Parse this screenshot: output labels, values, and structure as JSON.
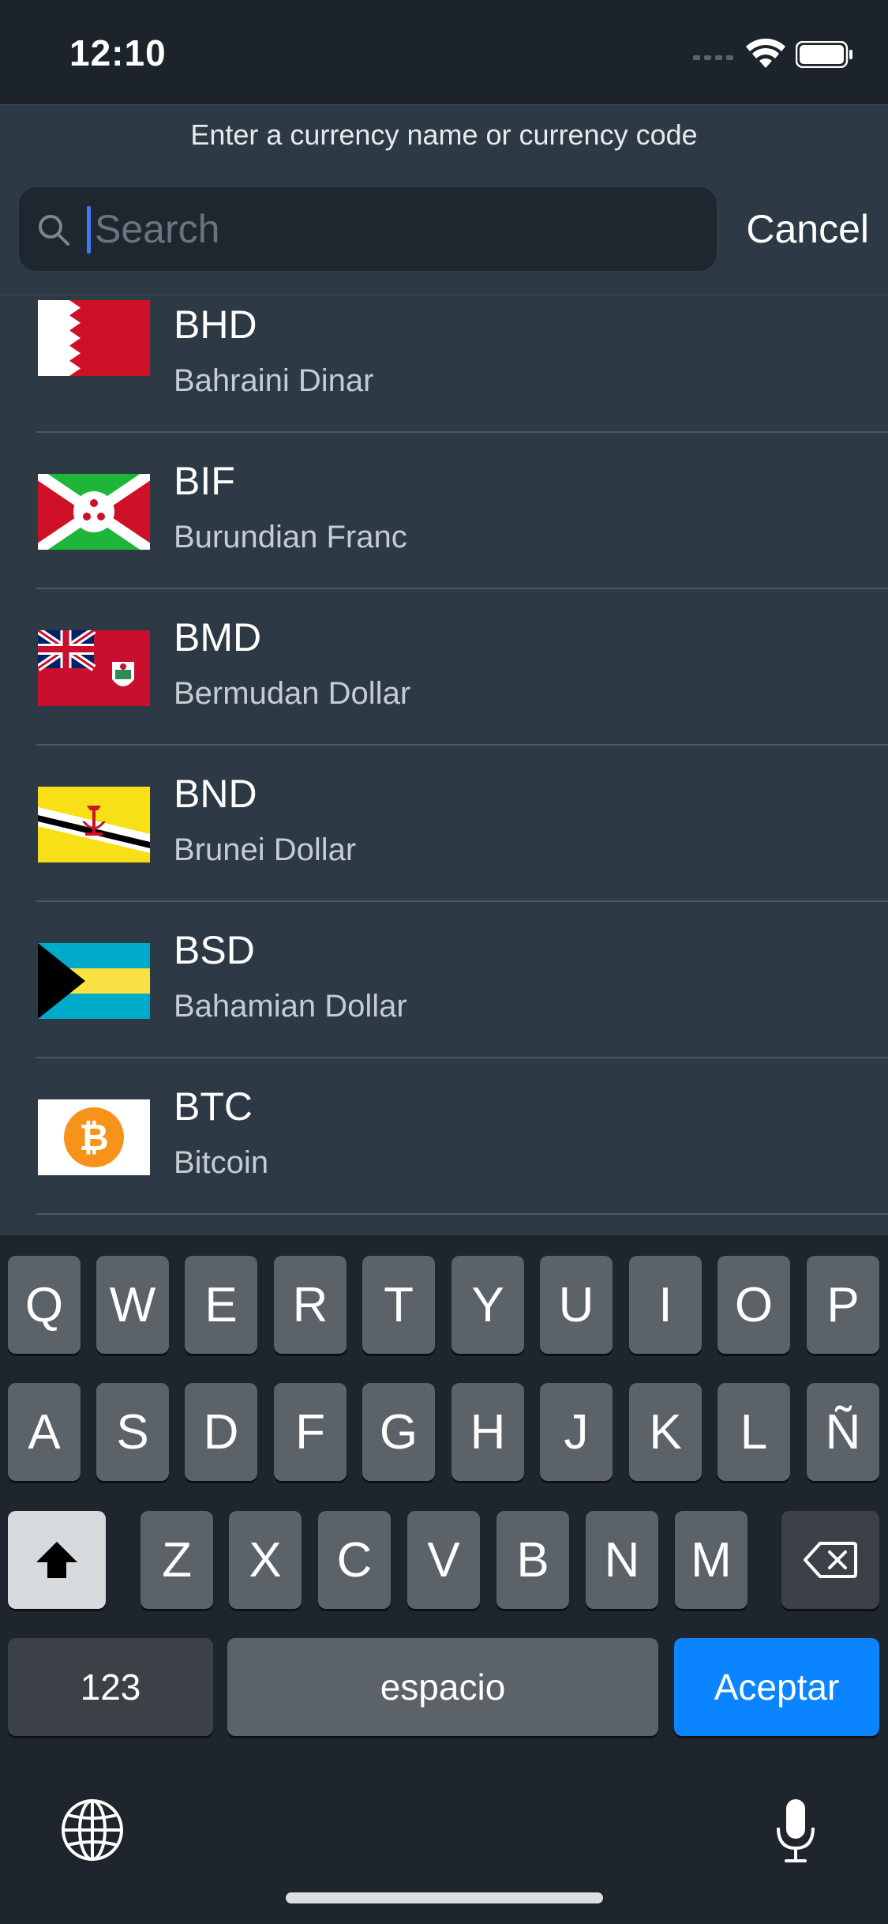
{
  "status_bar": {
    "time": "12:10"
  },
  "header": {
    "hint": "Enter a currency name or currency code"
  },
  "search": {
    "placeholder": "Search",
    "value": "",
    "cancel_label": "Cancel"
  },
  "currencies": [
    {
      "code": "BHD",
      "name": "Bahraini Dinar"
    },
    {
      "code": "BIF",
      "name": "Burundian Franc"
    },
    {
      "code": "BMD",
      "name": "Bermudan Dollar"
    },
    {
      "code": "BND",
      "name": "Brunei Dollar"
    },
    {
      "code": "BSD",
      "name": "Bahamian Dollar"
    },
    {
      "code": "BTC",
      "name": "Bitcoin"
    }
  ],
  "keyboard": {
    "row1": [
      "Q",
      "W",
      "E",
      "R",
      "T",
      "Y",
      "U",
      "I",
      "O",
      "P"
    ],
    "row2": [
      "A",
      "S",
      "D",
      "F",
      "G",
      "H",
      "J",
      "K",
      "L",
      "Ñ"
    ],
    "row3": [
      "Z",
      "X",
      "C",
      "V",
      "B",
      "N",
      "M"
    ],
    "numbers_label": "123",
    "space_label": "espacio",
    "return_label": "Aceptar",
    "icons": [
      "shift-icon",
      "delete-icon",
      "globe-icon",
      "microphone-icon"
    ]
  },
  "colors": {
    "accent": "#0a84ff",
    "caret": "#3d7bf4",
    "background": "#2d3a45"
  }
}
